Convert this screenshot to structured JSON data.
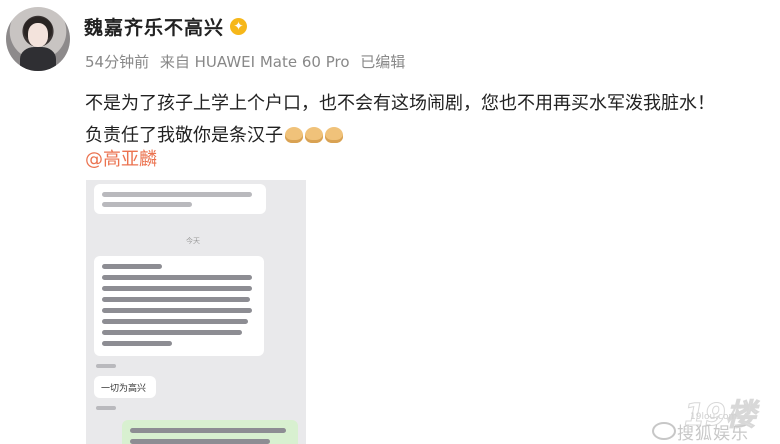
{
  "post": {
    "author": "魏嘉齐乐不高兴",
    "meta": {
      "time": "54分钟前",
      "source": "来自 HUAWEI Mate 60 Pro",
      "edited": "已编辑"
    },
    "text_line1": "不是为了孩子上学上个户口，也不会有这场闹剧，您也不用再买水军泼我脏水！",
    "text_line2": "负责任了我敬你是条汉子",
    "mention": "@高亚麟"
  },
  "screenshot": {
    "time_label": "今天",
    "messages": [
      {
        "side": "left",
        "text": "一切为高兴"
      }
    ]
  },
  "watermark": {
    "brand": "19楼",
    "site": "19lou.com",
    "platform": "搜狐娱乐"
  },
  "icons": [
    "avatar",
    "vip-badge-icon",
    "folded-hands-emoji",
    "weibo-logo-icon"
  ]
}
